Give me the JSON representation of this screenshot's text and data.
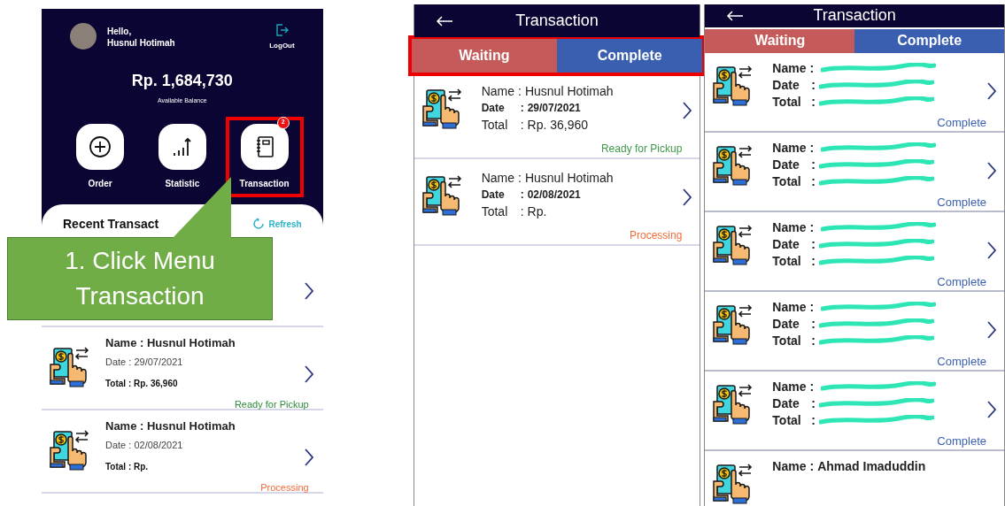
{
  "screens": [
    {
      "kind": "home",
      "greeting": "Hello,",
      "user_name": "Husnul Hotimah",
      "logout_label": "LogOut",
      "balance": "Rp. 1,684,730",
      "balance_caption": "Available Balance",
      "menu": [
        {
          "kind": "order",
          "label": "Order",
          "highlighted": false
        },
        {
          "kind": "statistic",
          "label": "Statistic",
          "highlighted": false
        },
        {
          "kind": "transaction",
          "label": "Transaction",
          "badge": "2",
          "highlighted": true
        }
      ],
      "recent_title": "Recent Transact",
      "refresh_label": "Refresh",
      "rows": [
        {
          "covered": true
        },
        {
          "name": "Name : Husnul Hotimah",
          "date": "Date : 29/07/2021",
          "total": "Total : Rp. 36,960",
          "status": "Ready for Pickup",
          "color": "#2e8b3a"
        },
        {
          "name": "Name : Husnul Hotimah",
          "date": "Date : 02/08/2021",
          "total": "Total : Rp.",
          "status": "Processing",
          "color": "#f26b3a"
        }
      ]
    },
    {
      "kind": "list",
      "title": "Transaction",
      "tabs_highlighted": true,
      "tabs": [
        {
          "label": "Waiting",
          "color": "#c55a5a"
        },
        {
          "label": "Complete",
          "color": "#3b5fb0"
        }
      ],
      "rows": [
        {
          "name_label": "Name",
          "separator": ":",
          "name": "Husnul Hotimah",
          "date_label": "Date",
          "date": "29/07/2021",
          "total_label": "Total",
          "total": "Rp. 36,960",
          "status": "Ready for Pickup",
          "color": "#3f9a4a"
        },
        {
          "name_label": "Name",
          "separator": ":",
          "name": "Husnul Hotimah",
          "date_label": "Date",
          "date": "02/08/2021",
          "total_label": "Total",
          "total": "Rp.",
          "status": "Processing",
          "color": "#f26b3a"
        }
      ]
    },
    {
      "kind": "list",
      "title": "Transaction",
      "tabs_highlighted": false,
      "tabs": [
        {
          "label": "Waiting",
          "color": "#c55a5a"
        },
        {
          "label": "Complete",
          "color": "#3b5fb0"
        }
      ],
      "rows": [
        {
          "name_label": "Name",
          "separator": ":",
          "redacted": true,
          "date_label": "Date",
          "total_label": "Total",
          "status": "Complete",
          "color": "#3b5fb0"
        },
        {
          "name_label": "Name",
          "separator": ":",
          "redacted": true,
          "date_label": "Date",
          "total_label": "Total",
          "status": "Complete",
          "color": "#3b5fb0"
        },
        {
          "name_label": "Name",
          "separator": ":",
          "redacted": true,
          "date_label": "Date",
          "total_label": "Total",
          "status": "Complete",
          "color": "#3b5fb0"
        },
        {
          "name_label": "Name",
          "separator": ":",
          "redacted": true,
          "date_label": "Date",
          "total_label": "Total",
          "status": "Complete",
          "color": "#3b5fb0"
        },
        {
          "name_label": "Name",
          "separator": ":",
          "redacted": true,
          "date_label": "Date",
          "total_label": "Total",
          "status": "Complete",
          "color": "#3b5fb0"
        },
        {
          "name_label": "Name",
          "separator": ":",
          "name": "Ahmad Imaduddin"
        }
      ]
    }
  ],
  "callout": {
    "text": "1. Click Menu Transaction"
  }
}
